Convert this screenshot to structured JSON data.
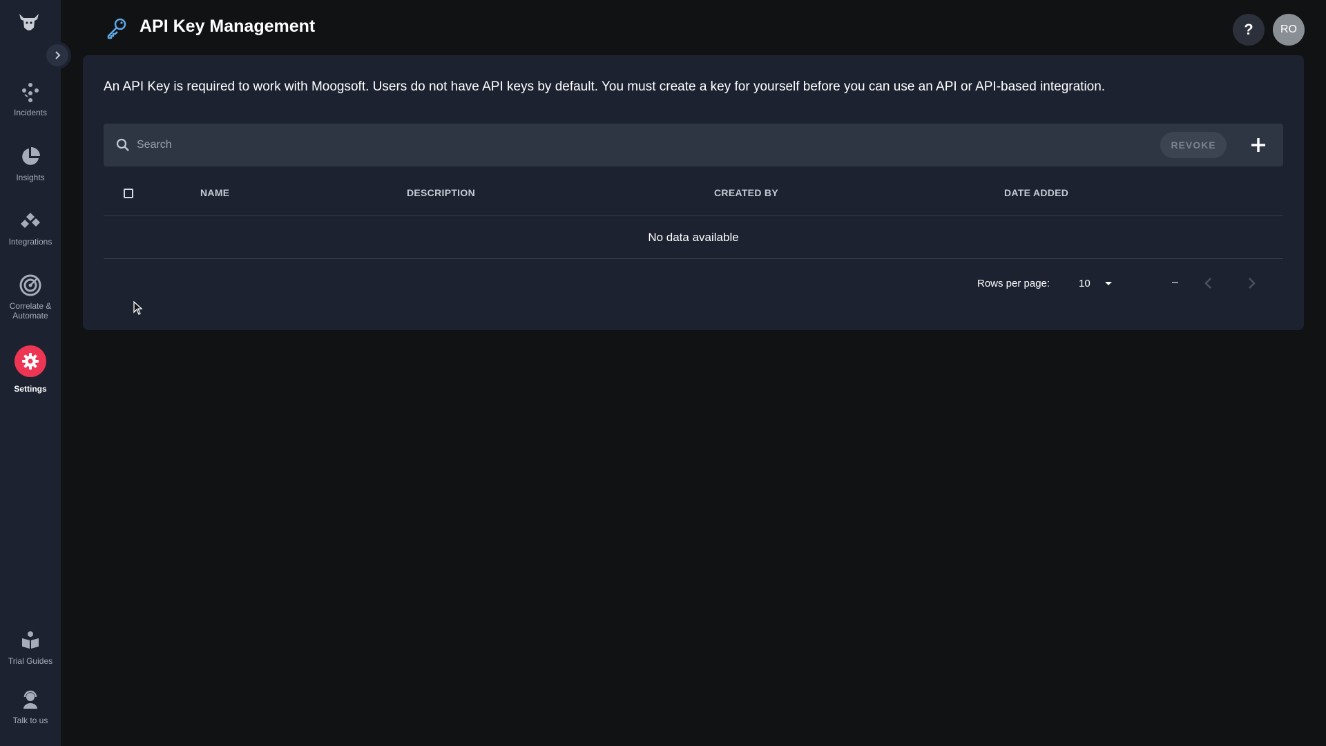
{
  "sidebar": {
    "items": [
      {
        "label": "Incidents",
        "icon": "incidents-icon"
      },
      {
        "label": "Insights",
        "icon": "pie-chart-icon"
      },
      {
        "label": "Integrations",
        "icon": "integrations-icon"
      },
      {
        "label": "Correlate &\nAutomate",
        "icon": "target-icon"
      },
      {
        "label": "Settings",
        "icon": "gear-icon",
        "active": true
      },
      {
        "label": "Trial Guides",
        "icon": "book-reader-icon"
      },
      {
        "label": "Talk to us",
        "icon": "support-agent-icon"
      }
    ]
  },
  "header": {
    "title": "API Key Management",
    "help_label": "?",
    "avatar_initials": "RO"
  },
  "content": {
    "intro": "An API Key is required to work with Moogsoft. Users do not have API keys by default. You must create a key for yourself before you can use an API or API-based integration.",
    "search_placeholder": "Search",
    "revoke_label": "REVOKE",
    "columns": [
      "NAME",
      "DESCRIPTION",
      "CREATED BY",
      "DATE ADDED"
    ],
    "empty_text": "No data available",
    "footer": {
      "rows_per_page_label": "Rows per page:",
      "rows_per_page_value": "10",
      "range_text": "–"
    }
  },
  "colors": {
    "sidebar_bg": "#1c2230",
    "page_bg": "#111214",
    "card_bg": "#1c2230",
    "toolbar_bg": "#2e3644",
    "accent_settings": "#ee3553",
    "key_icon": "#5fa8e8"
  }
}
